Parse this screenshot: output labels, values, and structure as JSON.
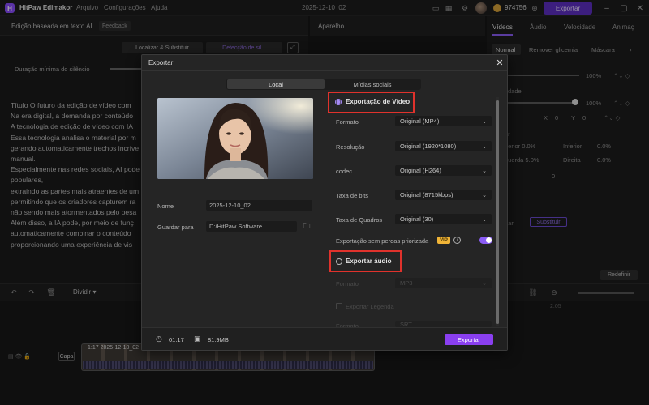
{
  "titlebar": {
    "app_name": "HitPaw Edimakor",
    "menu": [
      "Arquivo",
      "Configurações",
      "Ajuda"
    ],
    "doc_title": "2025-12-10_02",
    "coins": "974756",
    "export_label": "Exportar"
  },
  "left_panel": {
    "title": "Edição baseada em texto AI",
    "feedback": "Feedback",
    "find_replace": "Localizar & Substituir",
    "silence_detect": "Detecção de sil...",
    "silence_label": "Duração mínima do silêncio",
    "transcript": [
      "Título O futuro da edição de vídeo com",
      "Na era digital, a demanda por conteúdo",
      "A tecnologia de edição de vídeo com IA",
      "Essa tecnologia analisa o material por m",
      "gerando automaticamente trechos incríve",
      "manual.",
      "Especialmente nas redes sociais, AI pode",
      "populares,",
      "extraindo as partes mais atraentes de um",
      "permitindo que os criadores capturem ra",
      "não sendo mais atormentados pelo pesa",
      "Além disso, a IA pode, por meio de funç",
      "automaticamente combinar o conteúdo",
      "proporcionando uma experiência de vis"
    ]
  },
  "preview": {
    "title": "Aparelho"
  },
  "right_panel": {
    "tabs": [
      "Vídeos",
      "Áudio",
      "Velocidade",
      "Animaç"
    ],
    "subtabs": [
      "Normal",
      "Remover glicemia",
      "Máscara"
    ],
    "pct1": "100%",
    "opacity_label": "dade",
    "pct2": "100%",
    "x_label": "X",
    "x_val": "0",
    "y_label": "Y",
    "y_val": "0",
    "ar_label": "ar",
    "sup_label": "perior 0.0%",
    "inf_label": "Inferior",
    "inf_val": "0.0%",
    "esq_label": "querda 5.0%",
    "dir_label": "Direita",
    "dir_val": "0.0%",
    "rot_val": "0",
    "substituir": "Substituir",
    "redefinir": "Redefinir",
    "bar_label": "bar"
  },
  "timeline": {
    "dividir": "Dividir",
    "capa": "Capa",
    "clip_label": "1:17  2025-12-10_02",
    "tick": "2:05"
  },
  "dialog": {
    "title": "Exportar",
    "tabs": {
      "local": "Local",
      "social": "Mídias sociais"
    },
    "name_label": "Nome",
    "name_value": "2025-12-10_02",
    "save_label": "Guardar para",
    "save_value": "D:/HitPaw Software",
    "video_export": "Exportação de Vídeo",
    "rows": [
      {
        "label": "Formato",
        "value": "Original (MP4)"
      },
      {
        "label": "Resolução",
        "value": "Original (1920*1080)"
      },
      {
        "label": "codec",
        "value": "Original (H264)"
      },
      {
        "label": "Taxa de bits",
        "value": "Original (8715kbps)"
      },
      {
        "label": "Taxa de Quadros",
        "value": "Original (30)"
      }
    ],
    "lossless_label": "Exportação sem perdas priorizada",
    "vip": "VIP",
    "lossless_on": true,
    "audio_export": "Exportar áudio",
    "audio_format_label": "Formato",
    "audio_format_value": "MP3",
    "subtitle_label": "Exportar Legenda",
    "subtitle_format_label": "Formato",
    "subtitle_format_value": "SRT",
    "duration": "01:17",
    "size": "81.9MB",
    "export_button": "Exportar"
  }
}
